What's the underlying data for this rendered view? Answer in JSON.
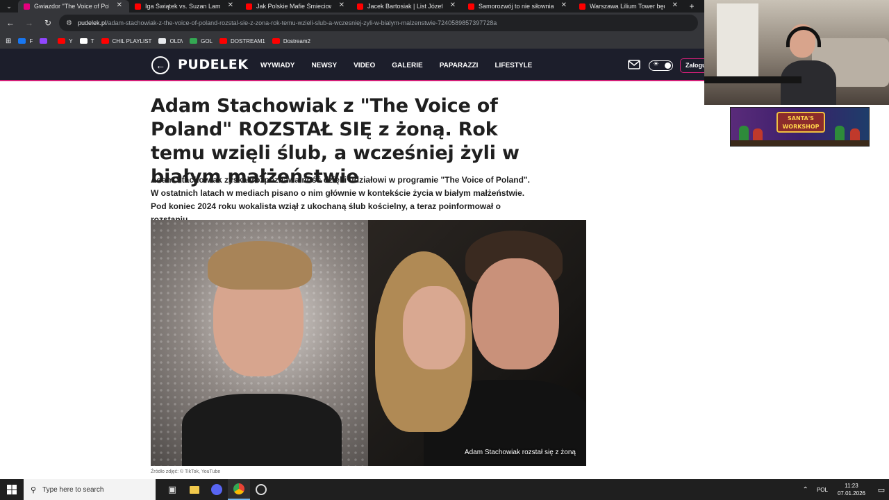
{
  "browser": {
    "tabs": [
      {
        "title": "Gwiazdor \"The Voice of Poland\"",
        "active": true,
        "favicon_color": "#e6007e"
      },
      {
        "title": "Iga Świątek vs. Suzan Lamens H",
        "active": false,
        "favicon_color": "#ff0000"
      },
      {
        "title": "Jak Polskie Mafie Śmieciowe Tr",
        "active": false,
        "favicon_color": "#ff0000"
      },
      {
        "title": "Jacek Bartosiak | List Józefa Piłs",
        "active": false,
        "favicon_color": "#ff0000"
      },
      {
        "title": "Samorozwój to nie siłownia, a w",
        "active": false,
        "favicon_color": "#ff0000"
      },
      {
        "title": "Warszawa Lilium Tower będzie",
        "active": false,
        "favicon_color": "#ff0000"
      }
    ],
    "url_domain": "pudelek.pl",
    "url_path": "/adam-stachowiak-z-the-voice-of-poland-rozstal-sie-z-zona-rok-temu-wzieli-slub-a-wczesniej-zyli-w-bialym-malzenstwie-7240589857397728a",
    "bookmarks": [
      {
        "label": "F",
        "color": "#1877f2"
      },
      {
        "label": "",
        "color": "#9146ff"
      },
      {
        "label": "Y",
        "color": "#ff0000"
      },
      {
        "label": "T",
        "color": "#ffffff"
      },
      {
        "label": "CHIL PLAYLIST",
        "color": "#ff0000"
      },
      {
        "label": "OLD\\",
        "color": "#e8eaed"
      },
      {
        "label": "GOL",
        "color": "#34a853"
      },
      {
        "label": "DOSTREAM1",
        "color": "#ff0000"
      },
      {
        "label": "Dostream2",
        "color": "#ff0000"
      }
    ]
  },
  "site": {
    "logo": "PUDELEK",
    "menu": [
      "WYWIADY",
      "NEWSY",
      "VIDEO",
      "GALERIE",
      "PAPARAZZI",
      "LIFESTYLE"
    ],
    "login_label": "Zaloguj",
    "accent_color": "#d41f78",
    "nav_bg": "#1c1e2b"
  },
  "article": {
    "headline": "Adam Stachowiak z \"The Voice of Poland\" ROZSTAŁ SIĘ z żoną. Rok temu wzięli ślub, a wcześniej żyli w białym małżeństwie",
    "lead": "Adam Stachowiak zyskał rozpoznawalność dzięki udziałowi w programie \"The Voice of Poland\". W ostatnich latach w mediach pisano o nim głównie w kontekście życia w białym małżeństwie. Pod koniec 2024 roku wokalista wziął z ukochaną ślub kościelny, a teraz poinformował o rozstaniu.",
    "image_caption": "Adam Stachowiak rozstał się z żoną",
    "image_credit": "Źródło zdjęć: © TikTok, YouTube"
  },
  "overlay": {
    "banner_text": "SANTA'S WORKSHOP"
  },
  "taskbar": {
    "search_placeholder": "Type here to search",
    "language": "POL",
    "time": "11:23",
    "date": "07.01.2026"
  }
}
